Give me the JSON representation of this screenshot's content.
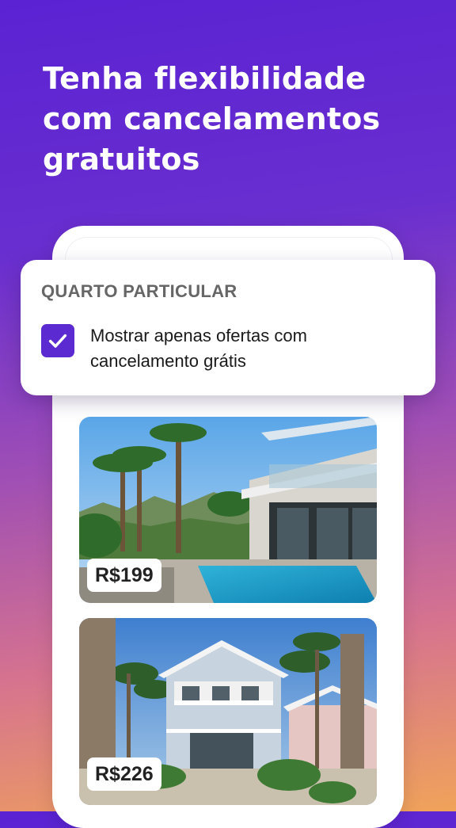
{
  "headline": {
    "line1": "Tenha flexibilidade",
    "line2": "com cancelamentos",
    "line3": "gratuitos"
  },
  "filter": {
    "title": "QUARTO PARTICULAR",
    "option_label": "Mostrar apenas ofertas com cancelamento grátis",
    "checked": true,
    "checkbox_color": "#5b2bd1"
  },
  "listings": [
    {
      "price": "R$199"
    },
    {
      "price": "R$226"
    }
  ],
  "colors": {
    "gradient_top": "#5a22d3",
    "gradient_bottom": "#f0a35a"
  }
}
